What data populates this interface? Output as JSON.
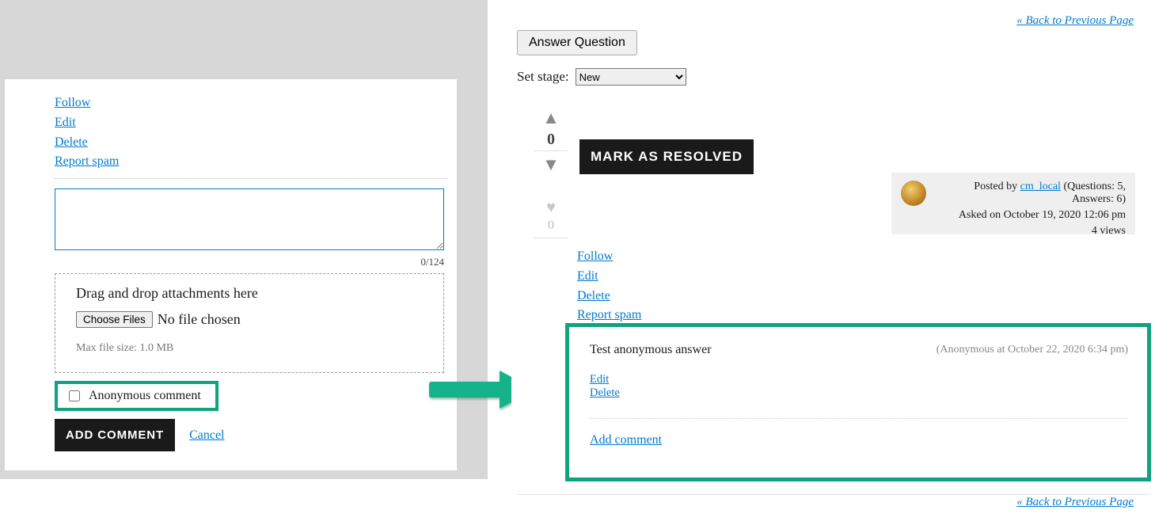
{
  "left": {
    "actions": {
      "follow": "Follow",
      "edit": "Edit",
      "delete": "Delete",
      "report": "Report spam"
    },
    "comment_value": "",
    "char_count": "0/124",
    "attach_heading": "Drag and drop attachments here",
    "choose_files_btn": "Choose Files",
    "file_status": "No file chosen",
    "max_size": "Max file size: 1.0 MB",
    "anon_label": "Anonymous comment",
    "add_comment_btn": "Add Comment",
    "cancel": "Cancel"
  },
  "right": {
    "back_link": "« Back to Previous Page",
    "answer_question_btn": "Answer Question",
    "set_stage_label": "Set stage:",
    "stage_value": "New",
    "vote": {
      "count": "0",
      "favorites": "0"
    },
    "resolved_btn": "Mark as Resolved",
    "meta": {
      "posted_by_prefix": "Posted by ",
      "user": "cm_local",
      "stats": " (Questions: 5, Answers: 6)",
      "asked": "Asked on October 19, 2020 12:06 pm",
      "views": "4 views"
    },
    "actions": {
      "follow": "Follow",
      "edit": "Edit",
      "delete": "Delete",
      "report": "Report spam"
    },
    "answer": {
      "title": "Test anonymous answer",
      "meta": "(Anonymous at October 22, 2020 6:34 pm)",
      "edit": "Edit",
      "delete": "Delete",
      "add_comment": "Add comment"
    }
  }
}
